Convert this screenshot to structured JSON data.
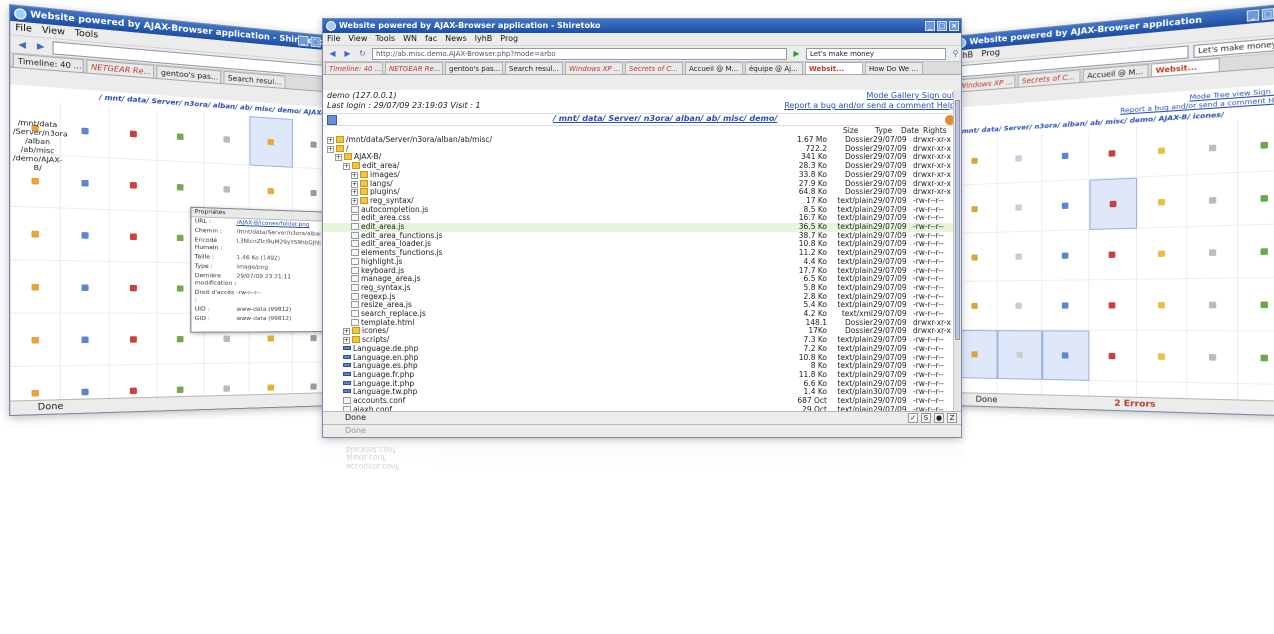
{
  "main": {
    "title": "Website powered by AJAX-Browser application - Shiretoko",
    "menu": [
      "File",
      "View",
      "Tools"
    ],
    "bookmarks": [
      "WN",
      "fac",
      "News",
      "lyhB",
      "Prog"
    ],
    "url": "http://ab.misc.demo.AJAX-Browser.php?mode=arbo",
    "search": "Let's make money",
    "tabs": [
      "Timeline: 40 ...",
      "NETGEAR Re...",
      "gentoo's pas...",
      "Search resul...",
      "Windows XP ...",
      "Secrets of C...",
      "Accueil @ M...",
      "équipe @ Aj...",
      "Websit...",
      "How Do We ..."
    ],
    "info": {
      "demo": "demo (127.0.0.1)",
      "login": "Last login : 29/07/09 23:19:03 Visit : 1",
      "links1": "Mode Gallery  Sign out",
      "links2": "Report a bug and/or send a comment  Help"
    },
    "path": "/ mnt/ data/ Server/ n3ora/ alban/ ab/ misc/ demo/",
    "columns": {
      "size": "Size",
      "type": "Type",
      "date": "Date",
      "rights": "Rights"
    },
    "root": "/mnt/data/Server/n3ora/alban/ab/misc/",
    "status": "Done",
    "rows": [
      {
        "name": "/mnt/data/Server/n3ora/alban/ab/misc/",
        "size": "1.67 Mo",
        "type": "Dossier",
        "date": "29/07/09",
        "rights": "drwxr-xr-x",
        "kind": "folder",
        "level": 0
      },
      {
        "name": "/",
        "size": "722.2",
        "type": "Dossier",
        "date": "29/07/09",
        "rights": "drwxr-xr-x",
        "kind": "folder",
        "level": 0
      },
      {
        "name": "AJAX-B/",
        "size": "341 Ko",
        "type": "Dossier",
        "date": "29/07/09",
        "rights": "drwxr-xr-x",
        "kind": "folder",
        "level": 1
      },
      {
        "name": "edit_area/",
        "size": "28.3 Ko",
        "type": "Dossier",
        "date": "29/07/09",
        "rights": "drwxr-xr-x",
        "kind": "folder",
        "level": 2
      },
      {
        "name": "images/",
        "size": "33.8 Ko",
        "type": "Dossier",
        "date": "29/07/09",
        "rights": "drwxr-xr-x",
        "kind": "folder",
        "level": 3
      },
      {
        "name": "langs/",
        "size": "27.9 Ko",
        "type": "Dossier",
        "date": "29/07/09",
        "rights": "drwxr-xr-x",
        "kind": "folder",
        "level": 3
      },
      {
        "name": "plugins/",
        "size": "64.8 Ko",
        "type": "Dossier",
        "date": "29/07/09",
        "rights": "drwxr-xr-x",
        "kind": "folder",
        "level": 3
      },
      {
        "name": "reg_syntax/",
        "size": "17 Ko",
        "type": "text/plain",
        "date": "29/07/09",
        "rights": "-rw-r--r--",
        "kind": "folder",
        "level": 3
      },
      {
        "name": "autocompletion.js",
        "size": "8.5 Ko",
        "type": "text/plain",
        "date": "29/07/09",
        "rights": "-rw-r--r--",
        "kind": "file",
        "level": 3
      },
      {
        "name": "edit_area.css",
        "size": "16.7 Ko",
        "type": "text/plain",
        "date": "29/07/09",
        "rights": "-rw-r--r--",
        "kind": "file",
        "level": 3
      },
      {
        "name": "edit_area.js",
        "size": "36.5 Ko",
        "type": "text/plain",
        "date": "29/07/09",
        "rights": "-rw-r--r--",
        "kind": "file",
        "level": 3,
        "selected": true
      },
      {
        "name": "edit_area_functions.js",
        "size": "38.7 Ko",
        "type": "text/plain",
        "date": "29/07/09",
        "rights": "-rw-r--r--",
        "kind": "file",
        "level": 3
      },
      {
        "name": "edit_area_loader.js",
        "size": "10.8 Ko",
        "type": "text/plain",
        "date": "29/07/09",
        "rights": "-rw-r--r--",
        "kind": "file",
        "level": 3
      },
      {
        "name": "elements_functions.js",
        "size": "11.2 Ko",
        "type": "text/plain",
        "date": "29/07/09",
        "rights": "-rw-r--r--",
        "kind": "file",
        "level": 3
      },
      {
        "name": "highlight.js",
        "size": "4.4 Ko",
        "type": "text/plain",
        "date": "29/07/09",
        "rights": "-rw-r--r--",
        "kind": "file",
        "level": 3
      },
      {
        "name": "keyboard.js",
        "size": "17.7 Ko",
        "type": "text/plain",
        "date": "29/07/09",
        "rights": "-rw-r--r--",
        "kind": "file",
        "level": 3
      },
      {
        "name": "manage_area.js",
        "size": "6.5 Ko",
        "type": "text/plain",
        "date": "29/07/09",
        "rights": "-rw-r--r--",
        "kind": "file",
        "level": 3
      },
      {
        "name": "reg_syntax.js",
        "size": "5.8 Ko",
        "type": "text/plain",
        "date": "29/07/09",
        "rights": "-rw-r--r--",
        "kind": "file",
        "level": 3
      },
      {
        "name": "regexp.js",
        "size": "2.8 Ko",
        "type": "text/plain",
        "date": "29/07/09",
        "rights": "-rw-r--r--",
        "kind": "file",
        "level": 3
      },
      {
        "name": "resize_area.js",
        "size": "5.4 Ko",
        "type": "text/plain",
        "date": "29/07/09",
        "rights": "-rw-r--r--",
        "kind": "file",
        "level": 3
      },
      {
        "name": "search_replace.js",
        "size": "4.2 Ko",
        "type": "text/xml",
        "date": "29/07/09",
        "rights": "-rw-r--r--",
        "kind": "file",
        "level": 3
      },
      {
        "name": "template.html",
        "size": "148.1",
        "type": "Dossier",
        "date": "29/07/09",
        "rights": "drwxr-xr-x",
        "kind": "file",
        "level": 3
      },
      {
        "name": "icones/",
        "size": "17Ko",
        "type": "Dossier",
        "date": "29/07/09",
        "rights": "drwxr-xr-x",
        "kind": "folder",
        "level": 2
      },
      {
        "name": "scripts/",
        "size": "7.3 Ko",
        "type": "text/plain",
        "date": "29/07/09",
        "rights": "-rw-r--r--",
        "kind": "folder",
        "level": 2
      },
      {
        "name": "Language.de.php",
        "size": "7.2 Ko",
        "type": "text/plain",
        "date": "29/07/09",
        "rights": "-rw-r--r--",
        "kind": "php",
        "level": 2
      },
      {
        "name": "Language.en.php",
        "size": "10.8 Ko",
        "type": "text/plain",
        "date": "29/07/09",
        "rights": "-rw-r--r--",
        "kind": "php",
        "level": 2
      },
      {
        "name": "Language.es.php",
        "size": "8 Ko",
        "type": "text/plain",
        "date": "29/07/09",
        "rights": "-rw-r--r--",
        "kind": "php",
        "level": 2
      },
      {
        "name": "Language.fr.php",
        "size": "11.8 Ko",
        "type": "text/plain",
        "date": "29/07/09",
        "rights": "-rw-r--r--",
        "kind": "php",
        "level": 2
      },
      {
        "name": "Language.it.php",
        "size": "6.6 Ko",
        "type": "text/plain",
        "date": "29/07/09",
        "rights": "-rw-r--r--",
        "kind": "php",
        "level": 2
      },
      {
        "name": "Language.tw.php",
        "size": "1.4 Ko",
        "type": "text/plain",
        "date": "30/07/09",
        "rights": "-rw-r--r--",
        "kind": "php",
        "level": 2
      },
      {
        "name": "accounts.conf",
        "size": "687 Oct",
        "type": "text/plain",
        "date": "29/07/09",
        "rights": "-rw-r--r--",
        "kind": "file",
        "level": 2
      },
      {
        "name": "ajaxb.conf",
        "size": "29 Oct",
        "type": "text/plain",
        "date": "29/07/09",
        "rights": "-rw-r--r--",
        "kind": "file",
        "level": 2
      },
      {
        "name": "blacklist.conf",
        "size": "",
        "type": "",
        "date": "",
        "rights": "",
        "kind": "file",
        "level": 2
      }
    ]
  },
  "left": {
    "title": "Website powered by AJAX-Browser application - Shiretoko",
    "menu": [
      "File",
      "View",
      "Tools"
    ],
    "info_demo": "demo (127.0.0.1)",
    "info_login": "Last login : 29/07/09 23:19:03 Visit : 1",
    "path": "/ mnt/ data/ Server/ n3ora/ alban/ ab/ misc/ demo/ AJAX-B/",
    "dir_label": "/mnt/data /Server/n3ora /alban /ab/misc /demo/AJAX-B/",
    "status": "Done",
    "props": {
      "title": "Propriétés",
      "rows": [
        {
          "k": "URL :",
          "v": "/AJAX-B/icones/folder.png",
          "link": true
        },
        {
          "k": "Chemin :",
          "v": "/mnt/data/Server/n3ora/alban/ab/misc/demo/AJAX-B/icones/",
          "link": false
        },
        {
          "k": "Encodé Humain :",
          "v": "L3NlcnZlci9uM29yYS9hbGJhbi9hYi9taXNjL2RlbW8v",
          "link": false
        },
        {
          "k": "Taille :",
          "v": "1.46 Ko (1492)",
          "link": false
        },
        {
          "k": "Type :",
          "v": "image/png",
          "link": false
        },
        {
          "k": "Dernière modification :",
          "v": "29/07/09 23:21:11",
          "link": false
        },
        {
          "k": "Droit d'accès :",
          "v": "-rw-r--r--",
          "link": false
        },
        {
          "k": "UID :",
          "v": "www-data (99812)",
          "link": false
        },
        {
          "k": "GID :",
          "v": "www-data (99812)",
          "link": false
        }
      ]
    }
  },
  "right": {
    "title": "Website powered by AJAX-Browser application",
    "menu": [
      "ShB",
      "Prog"
    ],
    "search": "Let's make money",
    "links1": "Mode Tree view  Sign out",
    "links2": "Report a bug and/or send a comment  Help",
    "path": "/ mnt/ data/ Server/ n3ora/ alban/ ab/ misc/ demo/ AJAX-B/ icones/",
    "errors": "2 Errors",
    "status": "Done"
  },
  "colors": {
    "accent": "#2a4fb7",
    "titlebar": "#1f4ea3",
    "selected_row": "#e7f6d8"
  }
}
